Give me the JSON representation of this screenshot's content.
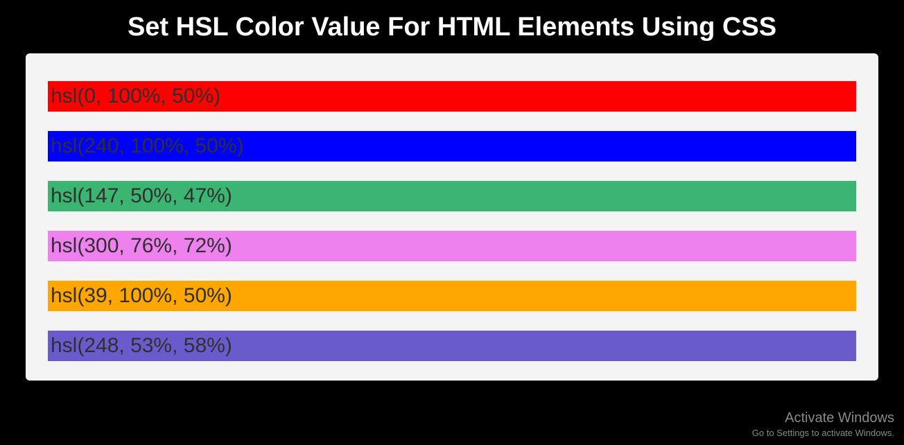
{
  "title": "Set HSL Color Value For HTML Elements Using CSS",
  "bars": [
    {
      "label": "hsl(0, 100%, 50%)"
    },
    {
      "label": "hsl(240, 100%, 50%)"
    },
    {
      "label": "hsl(147, 50%, 47%)"
    },
    {
      "label": "hsl(300, 76%, 72%)"
    },
    {
      "label": "hsl(39, 100%, 50%)"
    },
    {
      "label": "hsl(248, 53%, 58%)"
    }
  ],
  "watermark": {
    "title": "Activate Windows",
    "subtitle": "Go to Settings to activate Windows."
  }
}
